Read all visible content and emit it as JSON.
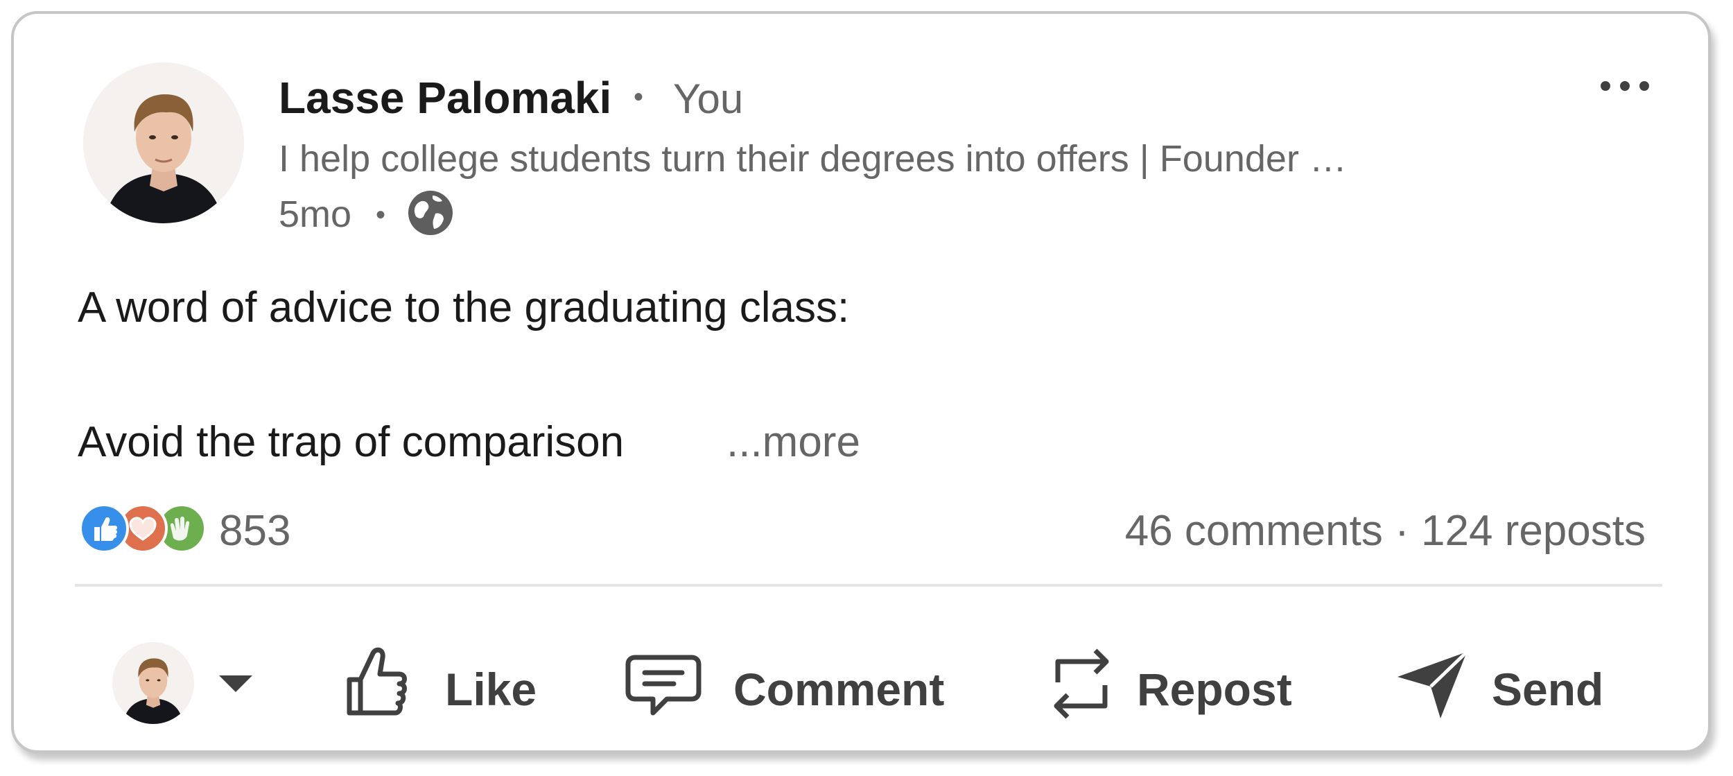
{
  "post": {
    "author_name": "Lasse Palomaki",
    "relationship": "You",
    "headline": "I help college students turn their degrees into offers | Founder …",
    "timestamp": "5mo",
    "visibility_icon": "globe-icon",
    "body_line_1": "A word of advice to the graduating class:",
    "body_line_2": "Avoid the trap of comparison",
    "see_more": "...more"
  },
  "social": {
    "reaction_count": "853",
    "comments": "46 comments",
    "separator": "·",
    "reposts": "124 reposts",
    "reaction_icons": [
      "like-reaction-icon",
      "love-reaction-icon",
      "celebrate-reaction-icon"
    ]
  },
  "actions": {
    "like": "Like",
    "comment": "Comment",
    "repost": "Repost",
    "send": "Send"
  },
  "colors": {
    "like_blue": "#378fe9",
    "love_orange": "#df704d",
    "celebrate_green": "#6dae4f",
    "text_primary": "#1a1a1a",
    "text_secondary": "#666666",
    "action_text": "#404040"
  }
}
